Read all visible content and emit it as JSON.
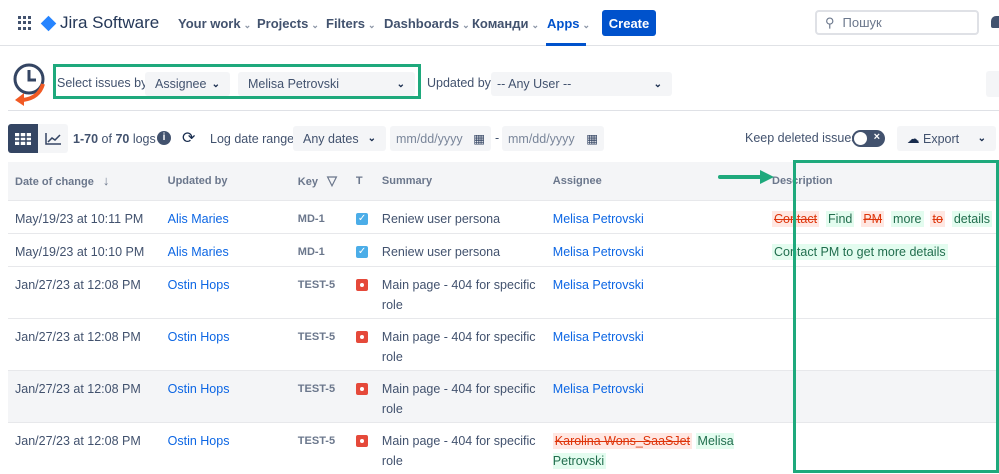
{
  "nav": {
    "brand": "Jira Software",
    "items": [
      "Your work",
      "Projects",
      "Filters",
      "Dashboards",
      "Команди",
      "Apps"
    ],
    "create": "Create",
    "search_placeholder": "Пошук"
  },
  "filters": {
    "select_label": "Select issues by:",
    "select_by": "Assignee",
    "select_value": "Melisa Petrovski",
    "updated_label": "Updated by:",
    "updated_value": "-- Any User --"
  },
  "toolbar": {
    "range_start": "1-70",
    "of": "of",
    "total": "70",
    "logs": "logs",
    "log_date_label": "Log date range:",
    "date_mode": "Any dates",
    "date_from": "mm/dd/yyyy",
    "dash": "-",
    "date_to": "mm/dd/yyyy",
    "keep_deleted": "Keep deleted issues",
    "export": "Export"
  },
  "columns": {
    "date": "Date of change",
    "updated_by": "Updated by",
    "key": "Key",
    "type": "T",
    "summary": "Summary",
    "assignee": "Assignee",
    "description": "Description"
  },
  "rows": [
    {
      "date": "May/19/23 at 10:11 PM",
      "updated_by": "Alis Maries",
      "key": "MD-1",
      "type": "task",
      "summary": "Reniew user persona",
      "assignee": "Melisa Petrovski"
    },
    {
      "date": "May/19/23 at 10:10 PM",
      "updated_by": "Alis Maries",
      "key": "MD-1",
      "type": "task",
      "summary": "Reniew user persona",
      "assignee": "Melisa Petrovski"
    },
    {
      "date": "Jan/27/23 at 12:08 PM",
      "updated_by": "Ostin Hops",
      "key": "TEST-5",
      "type": "bug",
      "summary": "Main page - 404 for specific role",
      "assignee": "Melisa Petrovski"
    },
    {
      "date": "Jan/27/23 at 12:08 PM",
      "updated_by": "Ostin Hops",
      "key": "TEST-5",
      "type": "bug",
      "summary": "Main page - 404 for specific role",
      "assignee": "Melisa Petrovski"
    },
    {
      "date": "Jan/27/23 at 12:08 PM",
      "updated_by": "Ostin Hops",
      "key": "TEST-5",
      "type": "bug",
      "summary": "Main page - 404 for specific role",
      "assignee": "Melisa Petrovski"
    },
    {
      "date": "Jan/27/23 at 12:08 PM",
      "updated_by": "Ostin Hops",
      "key": "TEST-5",
      "type": "bug",
      "summary": "Main page - 404 for specific role",
      "assignee_old": "Karolina Wons_SaaSJet",
      "assignee": "Melisa Petrovski"
    }
  ],
  "desc_diff": [
    {
      "t": "Contact",
      "op": "del"
    },
    {
      "t": "Find",
      "op": "ins"
    },
    {
      "t": "PM",
      "op": "del"
    },
    {
      "t": "more",
      "op": "ins"
    },
    {
      "t": "to",
      "op": "del"
    },
    {
      "t": "details",
      "op": "ins"
    }
  ],
  "desc_row2": "Contact PM to get more details",
  "colors": {
    "accent": "#0052cc",
    "highlight": "#1ea97c"
  }
}
